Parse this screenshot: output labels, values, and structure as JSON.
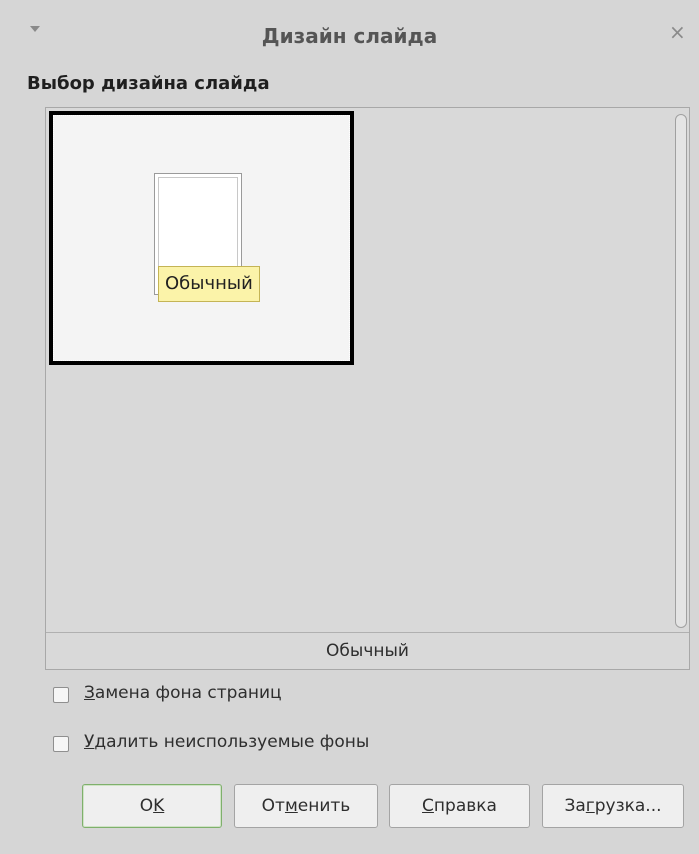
{
  "window": {
    "title": "Дизайн слайда",
    "menu_glyph": "▾",
    "close_glyph": "×"
  },
  "section": {
    "heading": "Выбор дизайна слайда"
  },
  "designs": {
    "items": [
      {
        "name": "Обычный",
        "selected": true
      }
    ],
    "tooltip": "Обычный",
    "selected_caption": "Обычный"
  },
  "options": {
    "replace_backgrounds": {
      "mnemonic": "З",
      "rest": "амена фона страниц",
      "checked": false
    },
    "delete_unused": {
      "mnemonic": "У",
      "rest": "далить неиспользуемые фоны",
      "checked": false
    }
  },
  "buttons": {
    "ok": {
      "pre": "О",
      "mnemonic": "K",
      "post": ""
    },
    "cancel": {
      "pre": "От",
      "mnemonic": "м",
      "post": "енить"
    },
    "help": {
      "pre": "",
      "mnemonic": "С",
      "post": "правка"
    },
    "load": {
      "pre": "За",
      "mnemonic": "г",
      "post": "рузка..."
    }
  },
  "colors": {
    "dialog_bg": "#d6d6d6",
    "tooltip_bg": "#fbf3a9",
    "default_button_border": "#7fb06c"
  }
}
